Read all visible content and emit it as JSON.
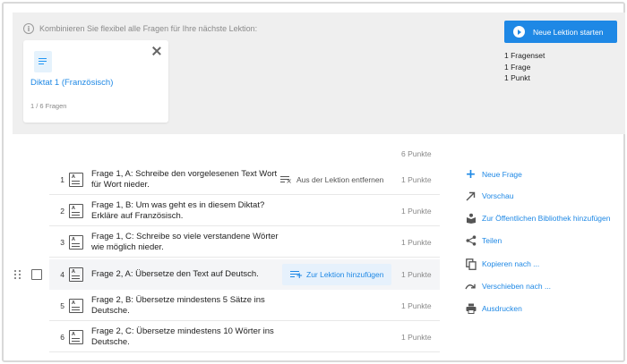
{
  "banner": {
    "info_text": "Kombinieren Sie flexibel alle Fragen für Ihre nächste Lektion:",
    "selected_card": {
      "title": "Diktat 1 (Französisch)",
      "count": "1 / 6 Fragen"
    },
    "start_button": "Neue Lektion starten",
    "summary": [
      "1 Fragenset",
      "1 Frage",
      "1 Punkt"
    ]
  },
  "list": {
    "total_points": "6 Punkte",
    "questions": [
      {
        "num": "1",
        "text": "Frage 1, A: Schreibe den vorgelesenen Text Wort für Wort nieder.",
        "points": "1 Punkte",
        "action": "Aus der Lektion entfernen"
      },
      {
        "num": "2",
        "text": "Frage 1, B: Um was geht es in diesem Diktat? Erkläre auf Französisch.",
        "points": "1 Punkte"
      },
      {
        "num": "3",
        "text": "Frage 1, C: Schreibe so viele verstandene Wörter wie möglich nieder.",
        "points": "1 Punkte"
      },
      {
        "num": "4",
        "text": "Frage 2, A: Übersetze den Text auf Deutsch.",
        "points": "1 Punkte",
        "action": "Zur Lektion hinzufügen"
      },
      {
        "num": "5",
        "text": "Frage 2, B: Übersetze mindestens 5 Sätze ins Deutsche.",
        "points": "1 Punkte"
      },
      {
        "num": "6",
        "text": "Frage 2, C: Übersetze mindestens 10 Wörter ins Deutsche.",
        "points": "1 Punkte"
      }
    ]
  },
  "actions": [
    {
      "label": "Neue Frage",
      "icon": "plus-icon"
    },
    {
      "label": "Vorschau",
      "icon": "arrow-icon"
    },
    {
      "label": "Zur Öffentlichen Bibliothek hinzufügen",
      "icon": "library-icon"
    },
    {
      "label": "Teilen",
      "icon": "share-icon"
    },
    {
      "label": "Kopieren nach ...",
      "icon": "copy-icon"
    },
    {
      "label": "Verschieben nach ...",
      "icon": "move-icon"
    },
    {
      "label": "Ausdrucken",
      "icon": "print-icon"
    }
  ],
  "colors": {
    "accent": "#1e88e5",
    "panel": "#efefef",
    "hover_row": "#f4f5f7"
  }
}
